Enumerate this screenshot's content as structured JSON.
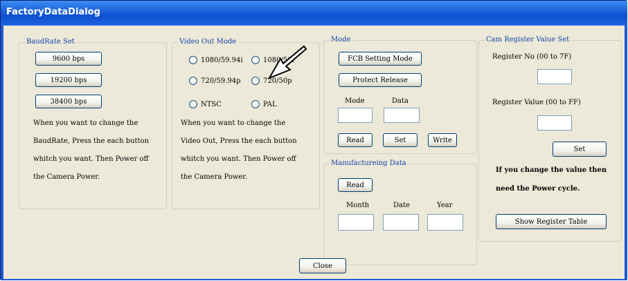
{
  "window": {
    "title": "FactoryDataDialog"
  },
  "baudrate": {
    "legend": "BaudRate Set",
    "buttons": [
      "9600 bps",
      "19200 bps",
      "38400 bps"
    ],
    "help": [
      "When you want to change the",
      "BaudRate, Press the each button",
      "whitch you want. Then Power off",
      "the Camera Power."
    ]
  },
  "video_out": {
    "legend": "Video Out Mode",
    "options": [
      "1080/59.94i",
      "1080/50i",
      "720/59.94p",
      "720/50p",
      "NTSC",
      "PAL"
    ],
    "help": [
      "When you want to change the",
      "Video Out, Press the each button",
      "whitch you want. Then Power off",
      "the Camera Power."
    ]
  },
  "mode": {
    "legend": "Mode",
    "fcb_button": "FCB Setting Mode",
    "protect_button": "Protect Release",
    "mode_label": "Mode",
    "data_label": "Data",
    "mode_value": "",
    "data_value": "",
    "read_button": "Read",
    "set_button": "Set",
    "write_button": "Write"
  },
  "manufacturing": {
    "legend": "Manufactureing Data",
    "read_button": "Read",
    "month_label": "Month",
    "date_label": "Date",
    "year_label": "Year",
    "month_value": "",
    "date_value": "",
    "year_value": ""
  },
  "cam_register": {
    "legend": "Cam Register Value Set",
    "register_no_label": "Register No (00 to 7F)",
    "register_no_value": "",
    "register_value_label": "Register Value (00 to FF)",
    "register_value_value": "",
    "set_button": "Set",
    "note_line1": "If you change the value then",
    "note_line2": "need the Power cycle.",
    "show_table_button": "Show Register Table"
  },
  "footer": {
    "close_button": "Close"
  },
  "overlay": {
    "pointer_icon": "arrow-pointer-icon"
  }
}
